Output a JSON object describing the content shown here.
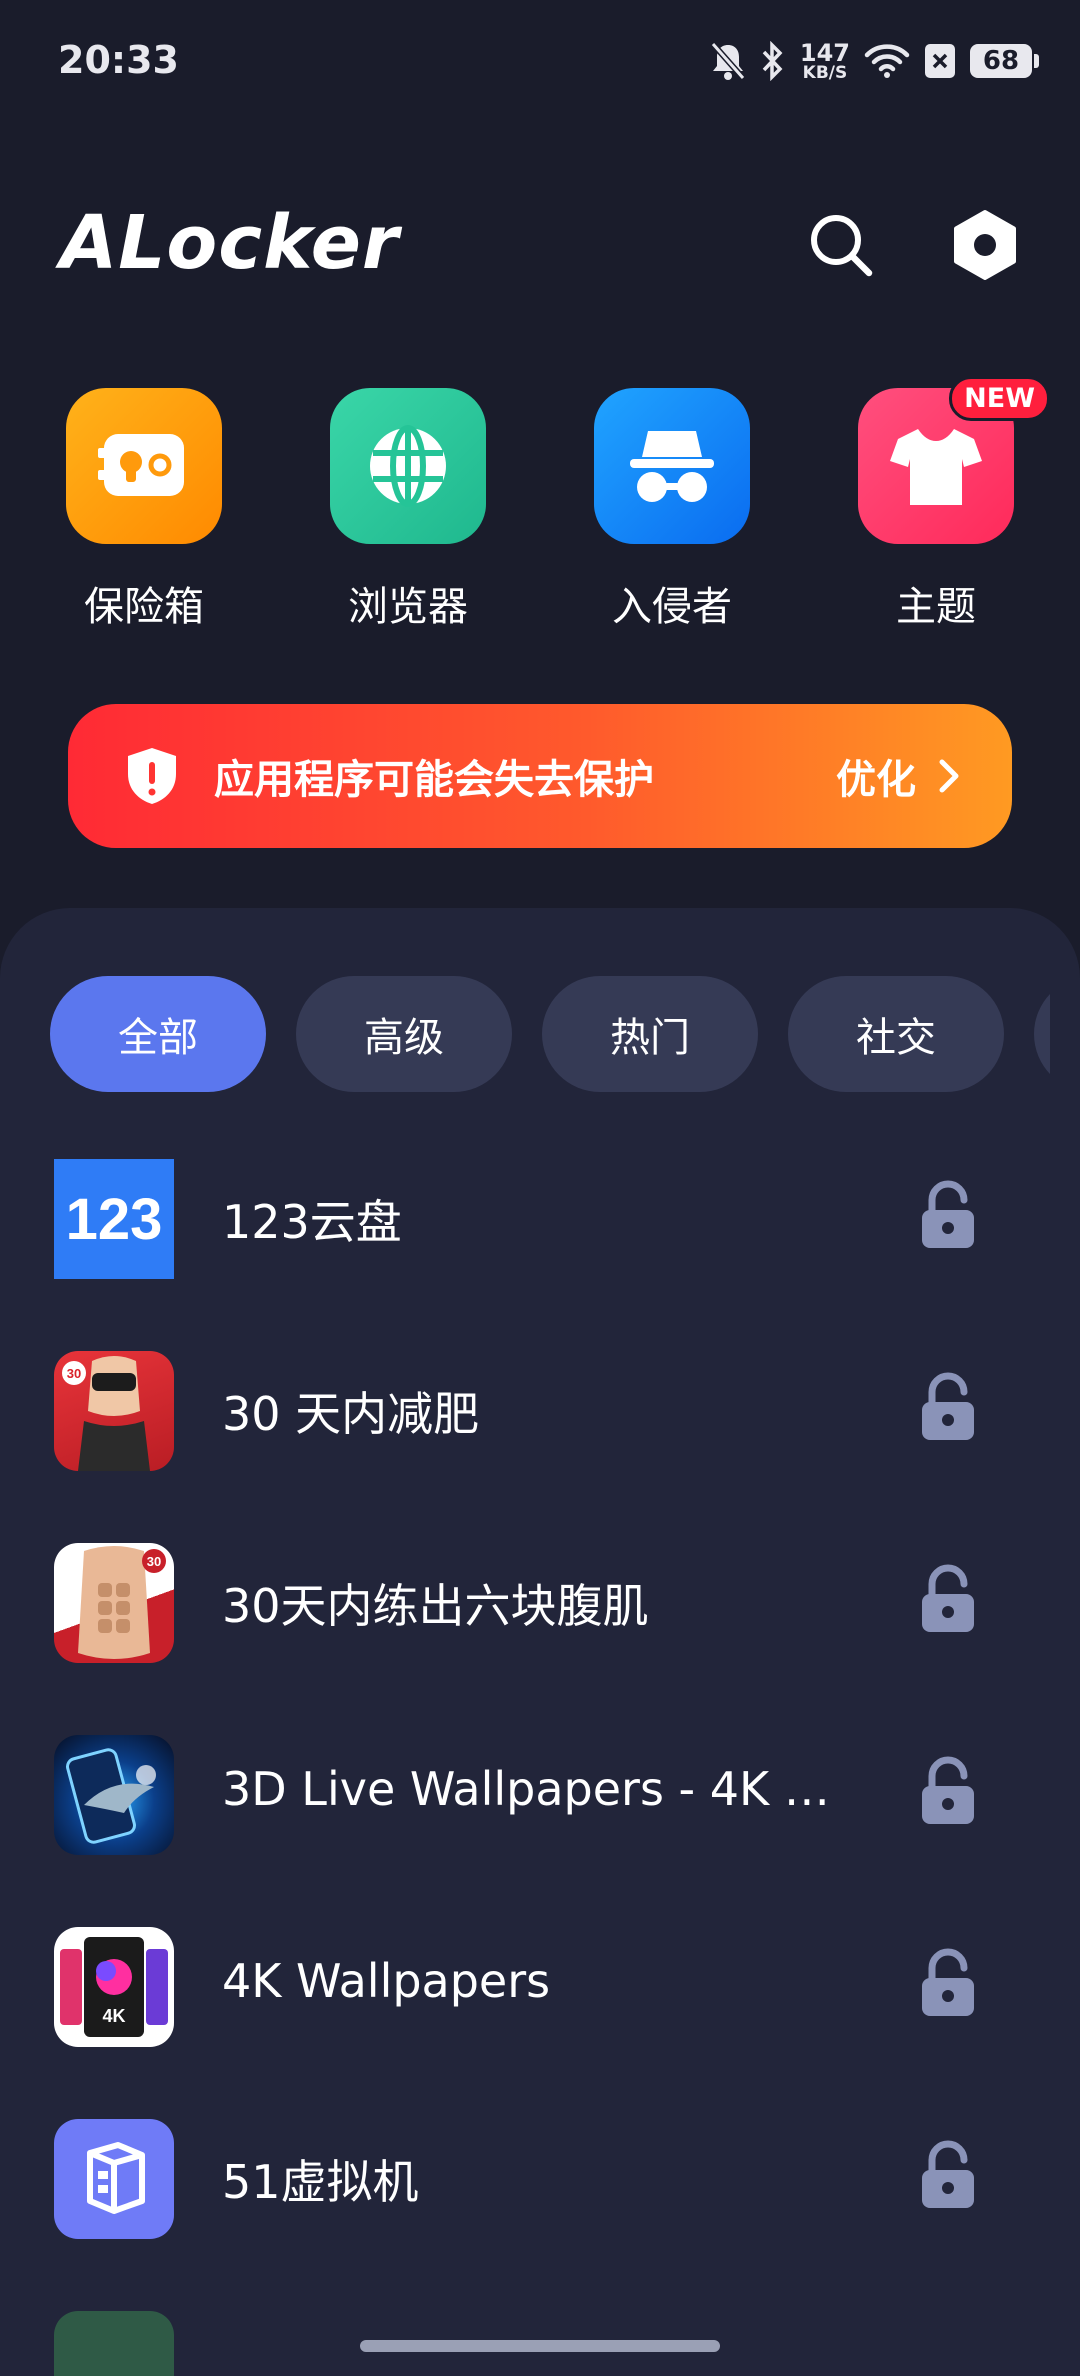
{
  "status_bar": {
    "time": "20:33",
    "net_speed_value": "147",
    "net_speed_unit": "KB/S",
    "battery": "68",
    "icons": [
      "bell-muted-icon",
      "bluetooth-icon",
      "wifi-icon",
      "close-box-icon",
      "battery-icon"
    ]
  },
  "header": {
    "title": "ALocker",
    "search_icon": "search-icon",
    "settings_icon": "hexagon-settings-icon"
  },
  "tiles": [
    {
      "label": "保险箱",
      "icon": "vault-icon",
      "color": "#ff9d0a"
    },
    {
      "label": "浏览器",
      "icon": "globe-icon",
      "color": "#27c79a"
    },
    {
      "label": "入侵者",
      "icon": "spy-icon",
      "color": "#1d8bff"
    },
    {
      "label": "主题",
      "icon": "tshirt-icon",
      "color": "#ff3a6d",
      "badge": "NEW"
    }
  ],
  "banner": {
    "text": "应用程序可能会失去保护",
    "action": "优化"
  },
  "chips": [
    {
      "label": "全部",
      "active": true
    },
    {
      "label": "高级",
      "active": false
    },
    {
      "label": "热门",
      "active": false
    },
    {
      "label": "社交",
      "active": false
    }
  ],
  "apps": [
    {
      "name": "123云盘",
      "locked": false
    },
    {
      "name": "30 天内减肥",
      "locked": false
    },
    {
      "name": "30天内练出六块腹肌",
      "locked": false
    },
    {
      "name": "3D Live Wallpapers - 4K & ...",
      "locked": false
    },
    {
      "name": "4K Wallpapers",
      "locked": false
    },
    {
      "name": "51虚拟机",
      "locked": false
    }
  ],
  "colors": {
    "background": "#1a1c2b",
    "panel": "#22253a",
    "chip": "#353a55",
    "chip_active": "#5b77ee",
    "lock": "#8a93b8"
  }
}
